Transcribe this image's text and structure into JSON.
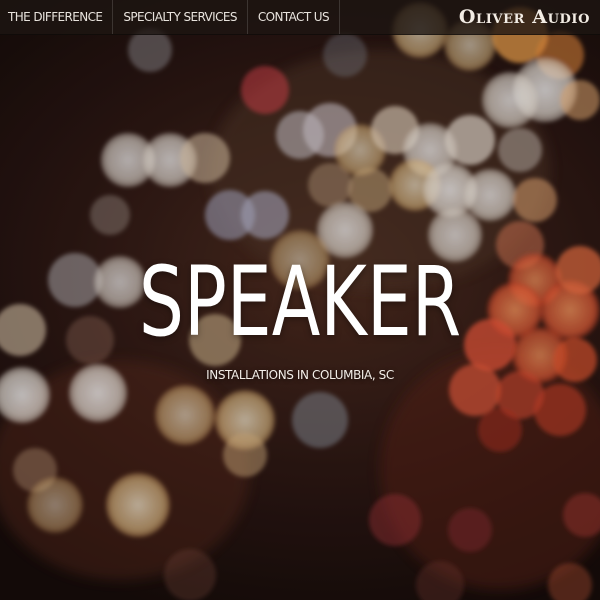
{
  "nav": {
    "items": [
      {
        "label": "THE DIFFERENCE"
      },
      {
        "label": "SPECIALTY SERVICES"
      },
      {
        "label": "CONTACT US"
      }
    ],
    "brand": "Oliver Audio"
  },
  "hero": {
    "title": "SPEAKER",
    "subtitle": "INSTALLATIONS IN COLUMBIA, SC"
  },
  "colors": {
    "background": "#2a1612",
    "nav_background": "#1e1612",
    "bokeh_white": "#f4efe6",
    "bokeh_warm": "#f2c98a",
    "bokeh_orange": "#ff7a3c",
    "bokeh_red": "#e84a2e"
  }
}
